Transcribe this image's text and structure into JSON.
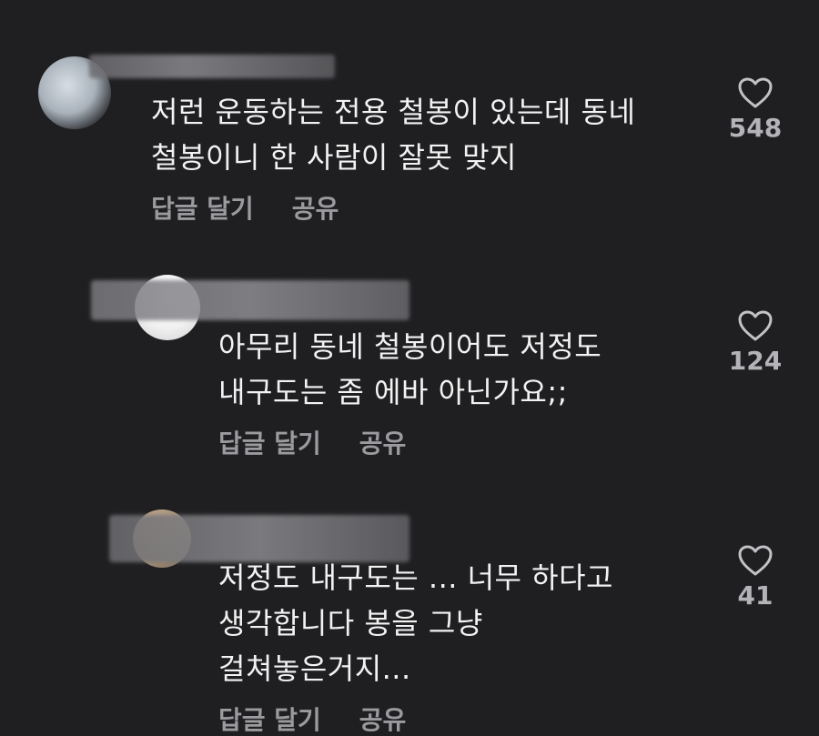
{
  "comments": [
    {
      "lines": [
        "저런 운동하는 전용 철봉이 있는데 동네",
        "철봉이니 한 사람이 잘못 맞지"
      ],
      "reply_label": "답글 달기",
      "share_label": "공유",
      "likes": "548"
    },
    {
      "lines": [
        "아무리 동네 철봉이어도 저정도",
        "내구도는 좀 에바 아닌가요;;"
      ],
      "reply_label": "답글 달기",
      "share_label": "공유",
      "likes": "124"
    },
    {
      "lines": [
        "저정도 내구도는 ... 너무 하다고",
        "생각합니다 봉을 그냥",
        "걸쳐놓은거지..."
      ],
      "reply_label": "답글 달기",
      "share_label": "공유",
      "likes": "41"
    }
  ]
}
